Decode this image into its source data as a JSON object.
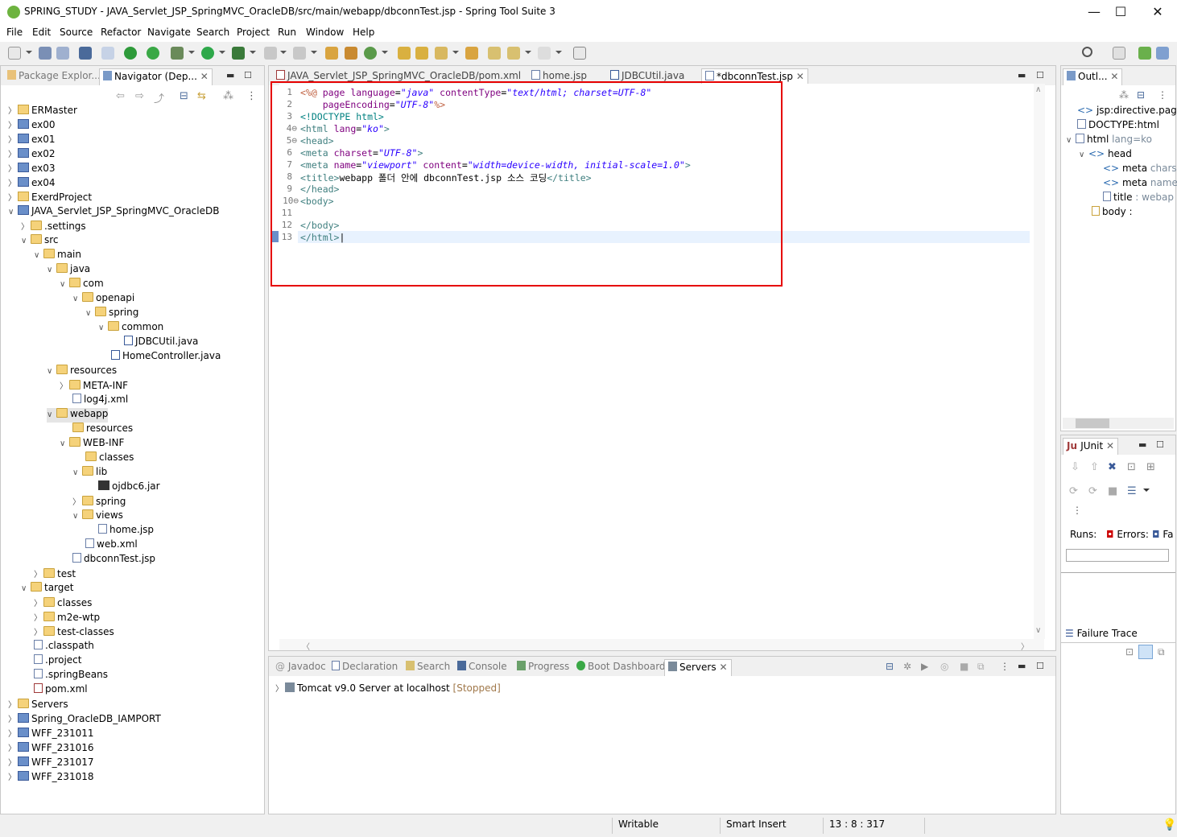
{
  "window": {
    "title": "SPRING_STUDY - JAVA_Servlet_JSP_SpringMVC_OracleDB/src/main/webapp/dbconnTest.jsp - Spring Tool Suite 3",
    "minimize": "—",
    "maximize": "☐",
    "close": "✕"
  },
  "menu": [
    "File",
    "Edit",
    "Source",
    "Refactor",
    "Navigate",
    "Search",
    "Project",
    "Run",
    "Window",
    "Help"
  ],
  "left_panel": {
    "tabs": [
      {
        "label": "Package Explor..."
      },
      {
        "label": "Navigator (Dep..."
      }
    ],
    "tree": [
      {
        "label": "ERMaster"
      },
      {
        "label": "ex00"
      },
      {
        "label": "ex01"
      },
      {
        "label": "ex02"
      },
      {
        "label": "ex03"
      },
      {
        "label": "ex04"
      },
      {
        "label": "ExerdProject"
      },
      {
        "label": "JAVA_Servlet_JSP_SpringMVC_OracleDB"
      },
      {
        "label": ".settings"
      },
      {
        "label": "src"
      },
      {
        "label": "main"
      },
      {
        "label": "java"
      },
      {
        "label": "com"
      },
      {
        "label": "openapi"
      },
      {
        "label": "spring"
      },
      {
        "label": "common"
      },
      {
        "label": "JDBCUtil.java"
      },
      {
        "label": "HomeController.java"
      },
      {
        "label": "resources"
      },
      {
        "label": "META-INF"
      },
      {
        "label": "log4j.xml"
      },
      {
        "label": "webapp"
      },
      {
        "label": "resources"
      },
      {
        "label": "WEB-INF"
      },
      {
        "label": "classes"
      },
      {
        "label": "lib"
      },
      {
        "label": "ojdbc6.jar"
      },
      {
        "label": "spring"
      },
      {
        "label": "views"
      },
      {
        "label": "home.jsp"
      },
      {
        "label": "web.xml"
      },
      {
        "label": "dbconnTest.jsp"
      },
      {
        "label": "test"
      },
      {
        "label": "target"
      },
      {
        "label": "classes"
      },
      {
        "label": "m2e-wtp"
      },
      {
        "label": "test-classes"
      },
      {
        "label": ".classpath"
      },
      {
        "label": ".project"
      },
      {
        "label": ".springBeans"
      },
      {
        "label": "pom.xml"
      },
      {
        "label": "Servers"
      },
      {
        "label": "Spring_OracleDB_IAMPORT"
      },
      {
        "label": "WFF_231011"
      },
      {
        "label": "WFF_231016"
      },
      {
        "label": "WFF_231017"
      },
      {
        "label": "WFF_231018"
      }
    ]
  },
  "editor": {
    "tabs": [
      {
        "label": "JAVA_Servlet_JSP_SpringMVC_OracleDB/pom.xml"
      },
      {
        "label": "home.jsp"
      },
      {
        "label": "JDBCUtil.java"
      },
      {
        "label": "*dbconnTest.jsp"
      }
    ],
    "line_numbers": [
      "1",
      "2",
      "3",
      "4⊖",
      "5⊖",
      "6",
      "7",
      "8",
      "9",
      "10⊖",
      "11",
      "12",
      "13"
    ]
  },
  "outline": {
    "tab": "Outl...",
    "items": [
      {
        "label": "jsp:directive.page l"
      },
      {
        "label": "DOCTYPE:html"
      },
      {
        "label": "html",
        "extra": "lang=ko"
      },
      {
        "label": "head"
      },
      {
        "label": "meta",
        "extra": "charse"
      },
      {
        "label": "meta",
        "extra": "name="
      },
      {
        "label": "title",
        "extra": ": webap"
      },
      {
        "label": "body",
        "extra": ":"
      }
    ]
  },
  "junit": {
    "tab": "JUnit",
    "runs": "Runs:",
    "errors": "Errors:",
    "failures": "Fa",
    "failure_trace": "Failure Trace"
  },
  "bottom_panel": {
    "tabs": [
      {
        "label": "Javadoc"
      },
      {
        "label": "Declaration"
      },
      {
        "label": "Search"
      },
      {
        "label": "Console"
      },
      {
        "label": "Progress"
      },
      {
        "label": "Boot Dashboard"
      },
      {
        "label": "Servers"
      }
    ],
    "server": {
      "name": "Tomcat v9.0 Server at localhost",
      "state": "[Stopped]"
    }
  },
  "status": {
    "writable": "Writable",
    "insert_mode": "Smart Insert",
    "position": "13 : 8 : 317"
  }
}
